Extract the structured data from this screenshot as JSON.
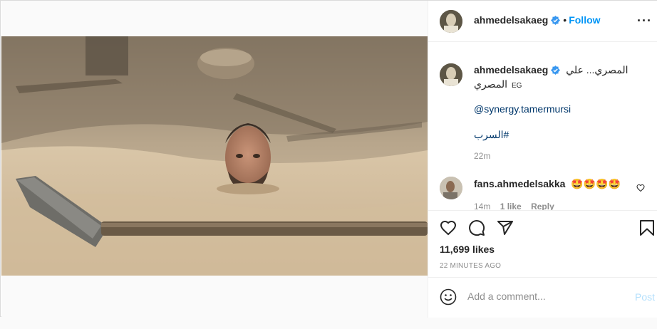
{
  "post": {
    "username": "ahmedelsakaeg",
    "follow_label": "Follow",
    "separator": "•",
    "more_label": "···",
    "caption_text": "المصري... علي",
    "caption_text_2": "المصري",
    "caption_flag": "EG",
    "mention": "@synergy.tamermursi",
    "hashtag": "#السرب",
    "caption_time": "22m",
    "likes": "11,699 likes",
    "posted_ago": "22 MINUTES AGO"
  },
  "comments": [
    {
      "username": "fans.ahmedelsakka",
      "text": "🤩🤩🤩🤩",
      "time": "14m",
      "likes": "1 like",
      "reply_label": "Reply"
    }
  ],
  "comment_box": {
    "placeholder": "Add a comment...",
    "post_label": "Post"
  },
  "icons": {
    "verified": "verified-badge-icon",
    "like": "heart-icon",
    "comment": "comment-icon",
    "share": "share-icon",
    "save": "bookmark-icon",
    "emoji": "emoji-icon"
  },
  "colors": {
    "link": "#00376b",
    "follow": "#0095f6",
    "post_disabled": "#b2dffc"
  }
}
